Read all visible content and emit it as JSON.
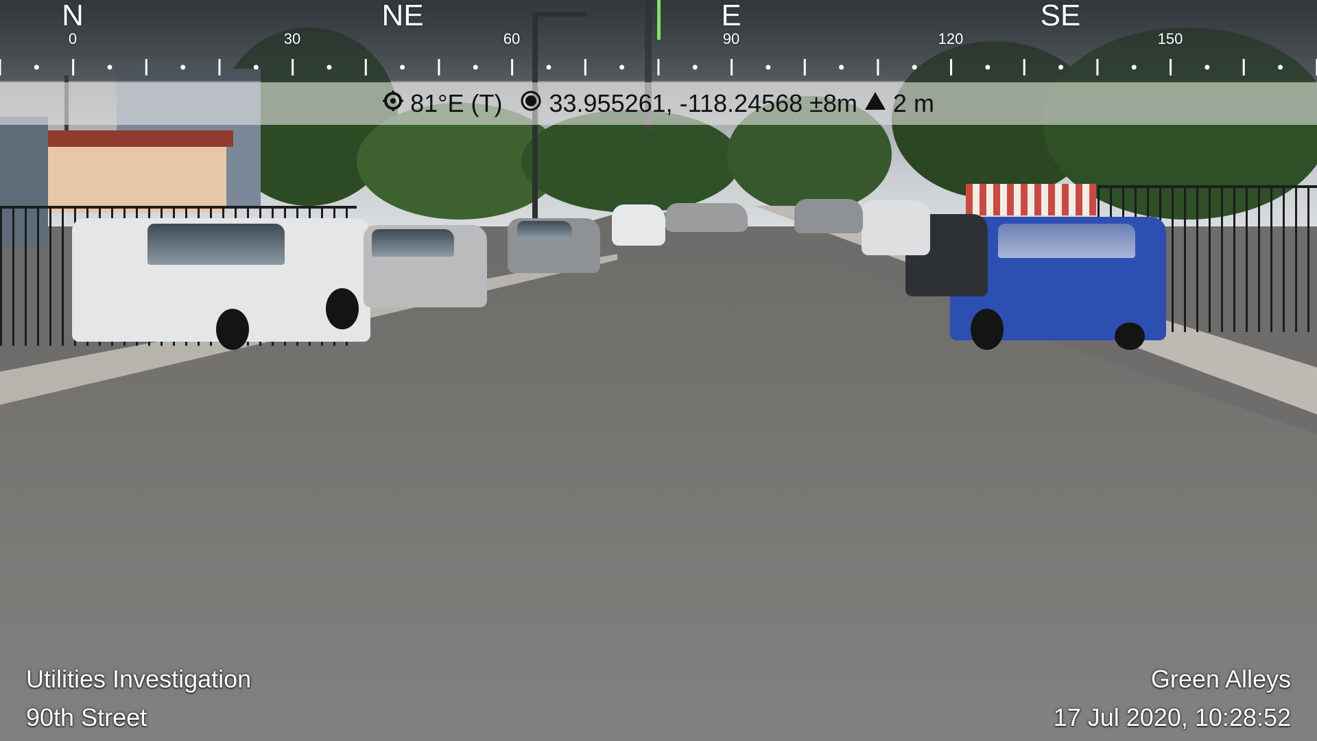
{
  "compass": {
    "cardinals": [
      "N",
      "NE",
      "E",
      "SE"
    ],
    "degrees": [
      "0",
      "30",
      "60",
      "90",
      "120",
      "150"
    ],
    "heading_marker_color": "#7ee36b"
  },
  "info_bar": {
    "heading_icon": "compass-rose-icon",
    "heading": "81°E (T)",
    "location_icon": "location-dot-icon",
    "coordinates": "33.955261, -118.24568 ±8m",
    "altitude_icon": "altitude-triangle-icon",
    "altitude": "2 m"
  },
  "caption_left": {
    "line1": "Utilities Investigation",
    "line2": "90th Street"
  },
  "caption_right": {
    "line1": "Green Alleys",
    "line2": "17 Jul 2020, 10:28:52"
  }
}
